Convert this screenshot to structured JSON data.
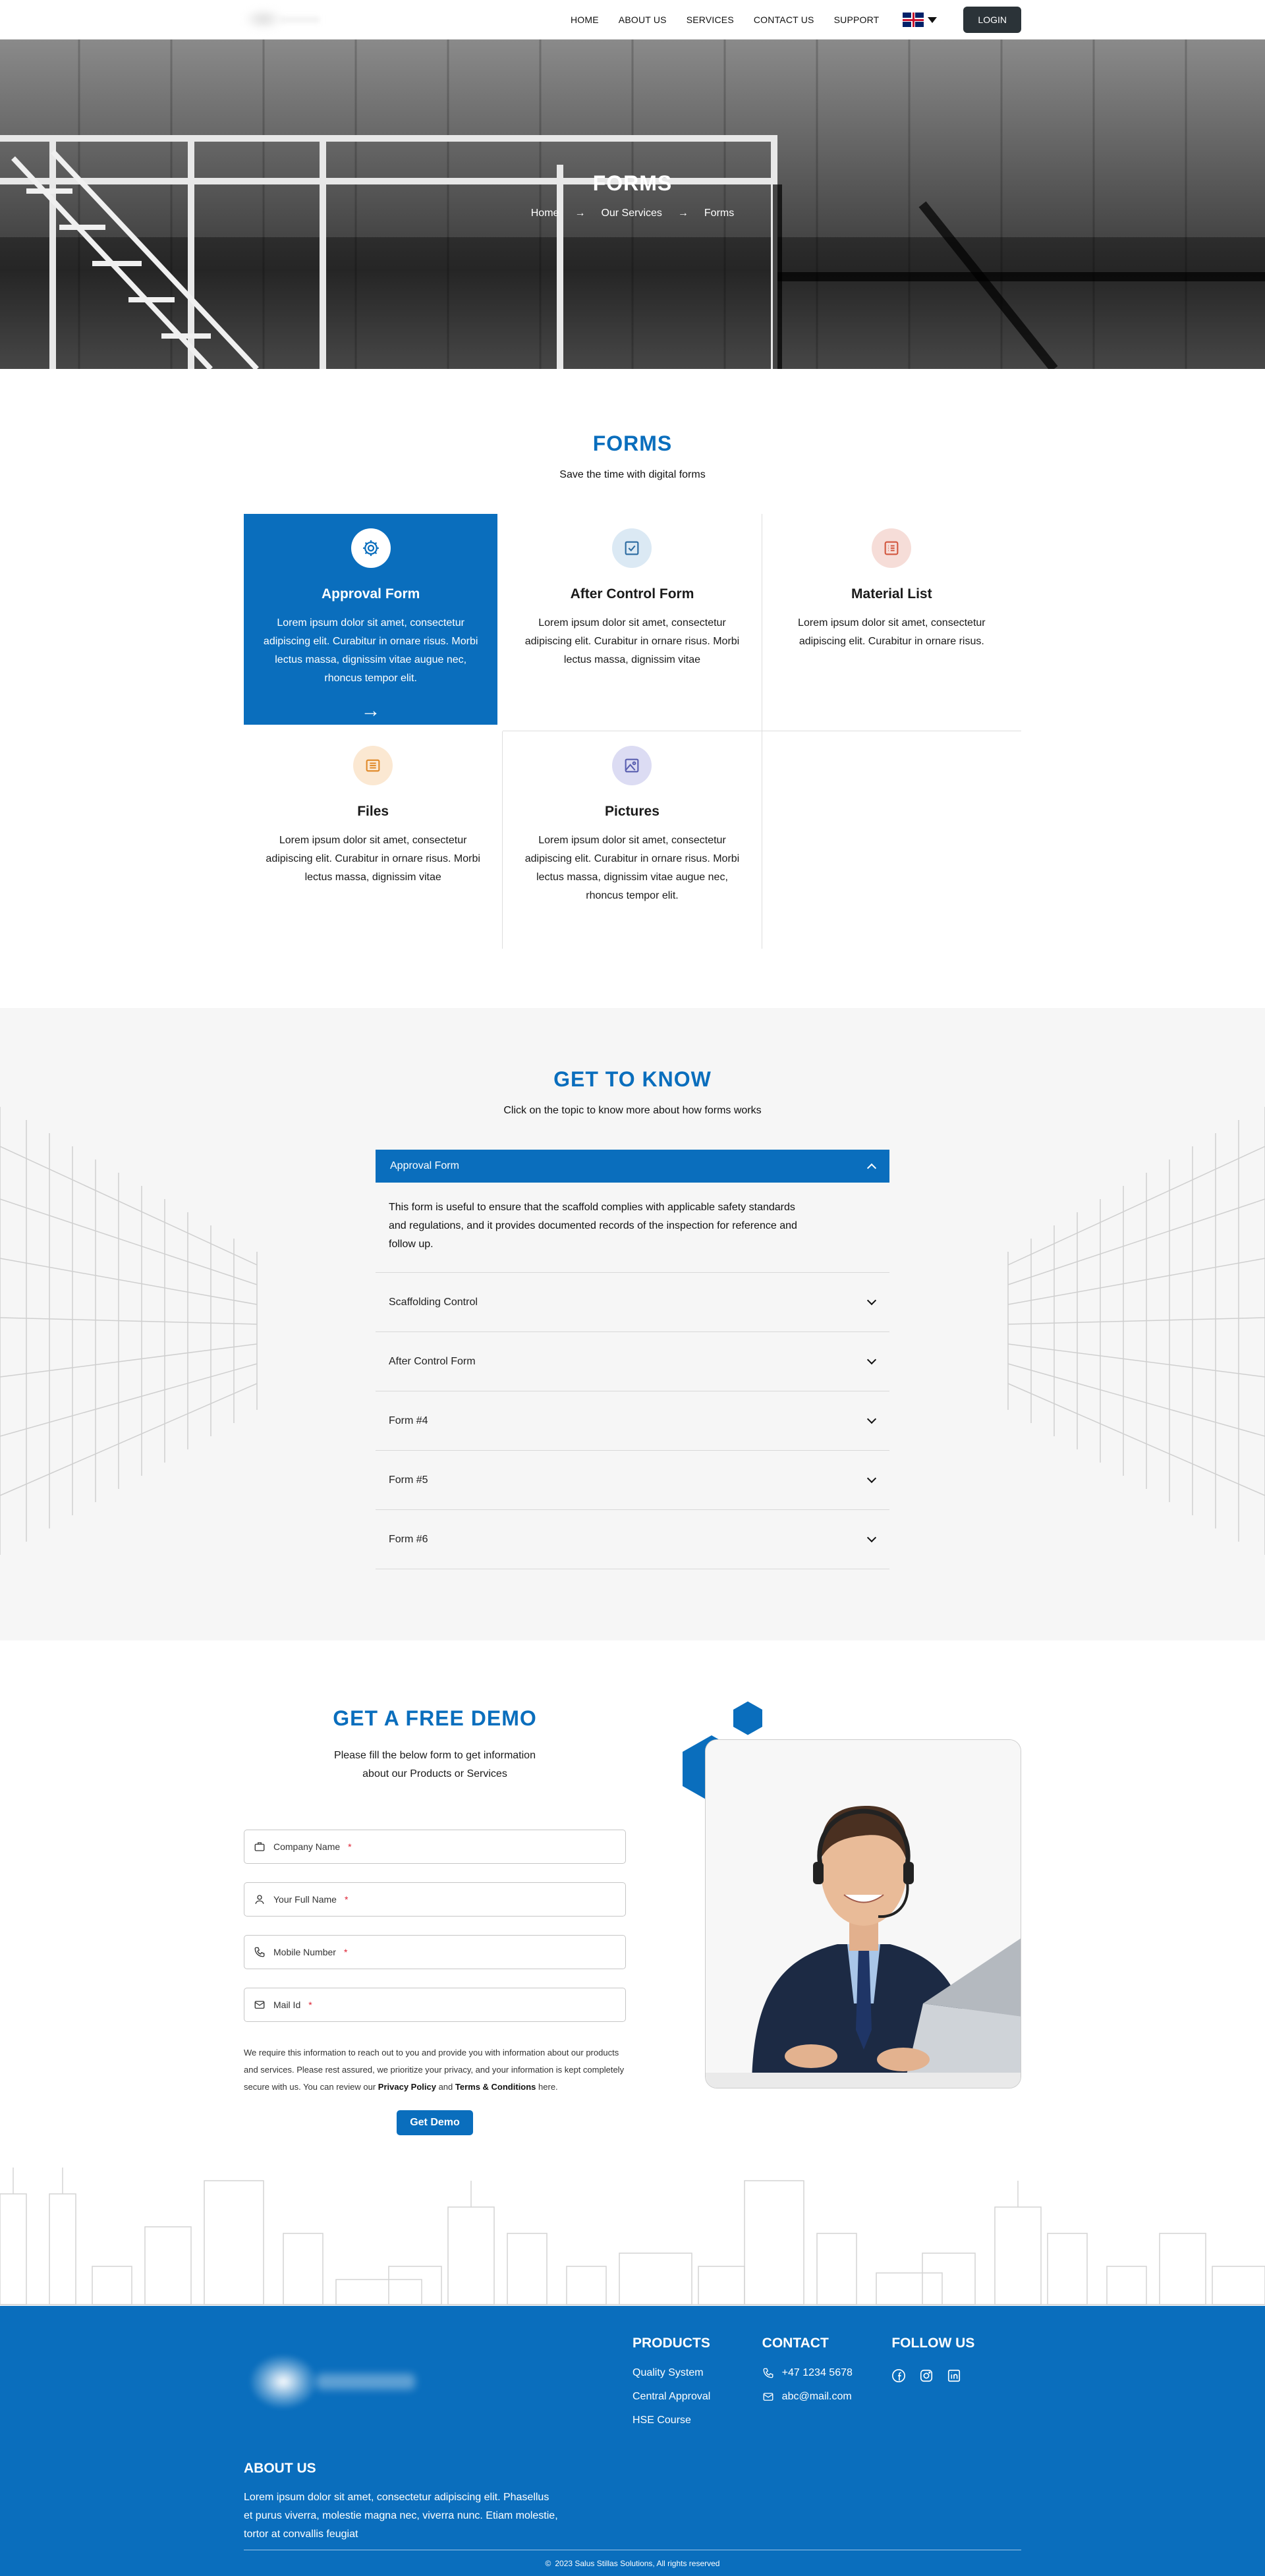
{
  "nav": {
    "links": [
      "HOME",
      "ABOUT US",
      "SERVICES",
      "CONTACT US",
      "SUPPORT"
    ],
    "login": "LOGIN"
  },
  "hero": {
    "title": "FORMS",
    "breadcrumb": [
      "Home",
      "Our Services",
      "Forms"
    ]
  },
  "forms": {
    "title": "FORMS",
    "subtitle": "Save the time with digital forms",
    "cards": [
      {
        "title": "Approval Form",
        "icon": "gear-icon",
        "text": "Lorem ipsum dolor sit amet, consectetur adipiscing elit. Curabitur in ornare risus. Morbi lectus massa, dignissim vitae augue nec, rhoncus tempor elit."
      },
      {
        "title": "After Control Form",
        "icon": "checkbox-icon",
        "text": "Lorem ipsum dolor sit amet, consectetur adipiscing elit. Curabitur in ornare risus. Morbi lectus massa, dignissim vitae"
      },
      {
        "title": "Material List",
        "icon": "list-icon",
        "text": "Lorem ipsum dolor sit amet, consectetur adipiscing elit. Curabitur in ornare risus."
      },
      {
        "title": "Files",
        "icon": "file-icon",
        "text": "Lorem ipsum dolor sit amet, consectetur adipiscing elit. Curabitur in ornare risus. Morbi lectus massa, dignissim vitae"
      },
      {
        "title": "Pictures",
        "icon": "image-icon",
        "text": "Lorem ipsum dolor sit amet, consectetur adipiscing elit. Curabitur in ornare risus. Morbi lectus massa, dignissim vitae augue nec, rhoncus tempor elit."
      }
    ]
  },
  "know": {
    "title": "GET TO KNOW",
    "subtitle": "Click on the topic to know more about how forms works",
    "open_item": "Approval Form",
    "open_text": "This form is useful to ensure that the scaffold complies with applicable safety standards and regulations, and it provides documented records of the inspection for reference and follow up.",
    "items": [
      "Scaffolding Control",
      "After Control Form",
      "Form #4",
      "Form #5",
      "Form #6"
    ]
  },
  "demo": {
    "title": "GET A FREE DEMO",
    "subtitle_1": "Please fill the below form to get information",
    "subtitle_2": "about our Products or Services",
    "fields": [
      "Company Name",
      "Your Full Name",
      "Mobile Number",
      "Mail Id"
    ],
    "required_mark": "*",
    "note_1": "We require this information to reach out to you and provide you with information about our products and services. Please rest assured, we prioritize your privacy, and your information is kept completely secure with us. You can review our ",
    "privacy": "Privacy Policy",
    "note_and": " and ",
    "terms": "Terms & Conditions",
    "note_end": " here.",
    "button": "Get Demo"
  },
  "footer": {
    "about_title": "ABOUT US",
    "about_text": "Lorem ipsum dolor sit amet, consectetur adipiscing elit. Phasellus et purus viverra, molestie magna nec, viverra nunc. Etiam molestie, tortor at convallis feugiat",
    "products_title": "PRODUCTS",
    "products": [
      "Quality System",
      "Central Approval",
      "HSE Course"
    ],
    "contact_title": "CONTACT",
    "phone": "+47 1234 5678",
    "email": "abc@mail.com",
    "follow_title": "FOLLOW US",
    "copyright": "2023 Salus Stillas Solutions, All rights reserved"
  },
  "colors": {
    "accent": "#0a6ebd",
    "dark_button": "#2b3338"
  }
}
